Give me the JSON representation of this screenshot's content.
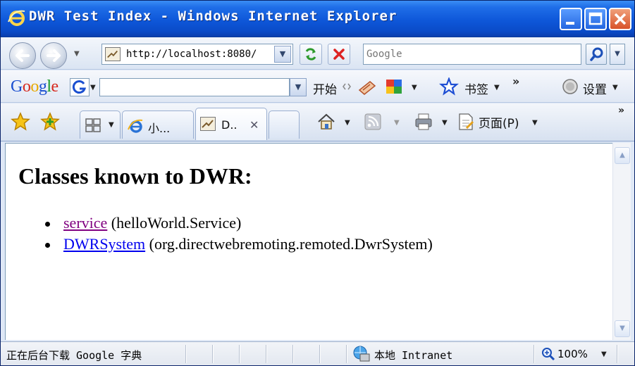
{
  "window": {
    "title": "DWR Test Index - Windows Internet Explorer"
  },
  "nav": {
    "url": "http://localhost:8080/",
    "search_placeholder": "Google"
  },
  "google_toolbar": {
    "logo": {
      "g1": "G",
      "o1": "o",
      "o2": "o",
      "g2": "g",
      "l": "l",
      "e": "e"
    },
    "start_label": "开始",
    "bookmarks_label": "书签",
    "more_label": "»",
    "settings_label": "设置"
  },
  "tabs": [
    {
      "label": "小..."
    },
    {
      "label": "D..",
      "close": "✕"
    }
  ],
  "commandbar": {
    "page_label": "页面(P)",
    "more_label": "»"
  },
  "page": {
    "heading": "Classes known to DWR:",
    "classes": [
      {
        "link": "service",
        "detail": "(helloWorld.Service)",
        "visited": true
      },
      {
        "link": "DWRSystem",
        "detail": "(org.directwebremoting.remoted.DwrSystem)",
        "visited": false
      }
    ]
  },
  "status": {
    "text": "正在后台下载 Google 字典",
    "zone": "本地 Intranet",
    "zoom": "100%"
  },
  "colors": {
    "link_visited": "#800080",
    "link_unvisited": "#0000ee",
    "titlebar": "#0e57d9"
  }
}
